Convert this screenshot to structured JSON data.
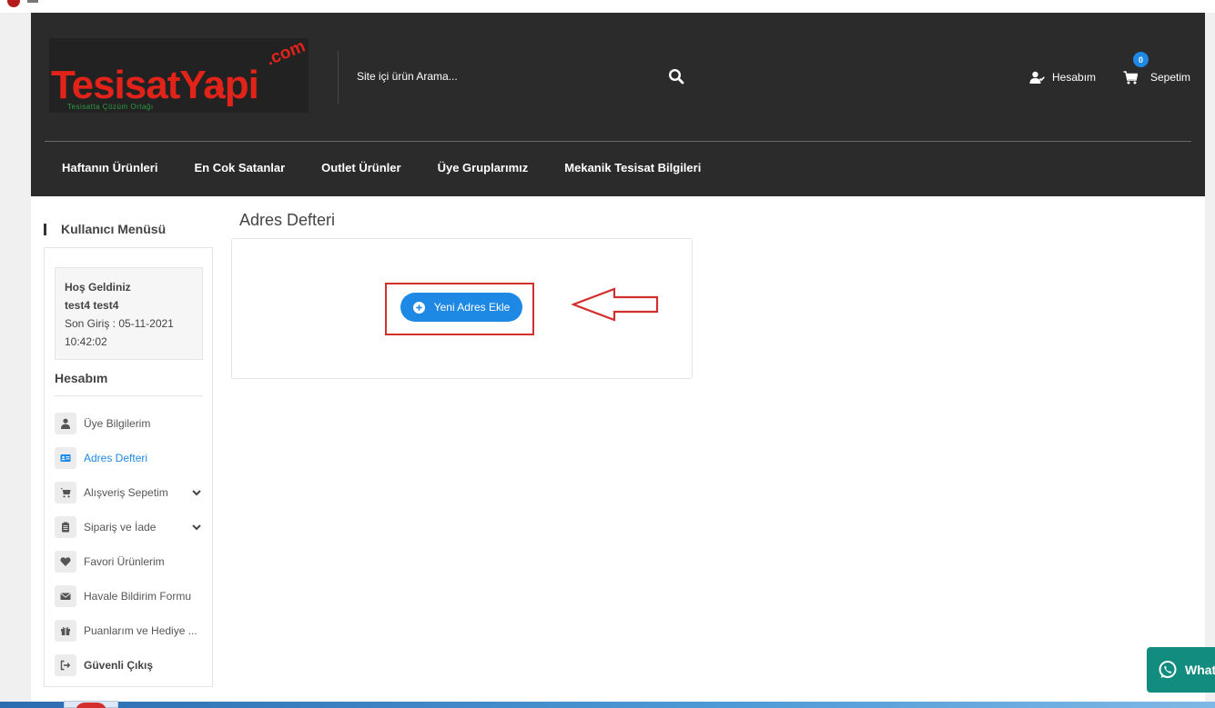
{
  "header": {
    "logo": {
      "main": "TesisatYapi",
      "com": ".com",
      "tagline": "Tesisatta Çözüm Ortağı"
    },
    "search": {
      "placeholder": "Site içi ürün Arama...",
      "icon": "search-icon"
    },
    "account_label": "Hesabım",
    "cart_label": "Sepetim",
    "cart_count": "0",
    "nav": [
      "Haftanın Ürünleri",
      "En Cok Satanlar",
      "Outlet Ürünler",
      "Üye Gruplarımız",
      "Mekanik Tesisat Bilgileri"
    ]
  },
  "sidebar": {
    "title": "Kullanıcı Menüsü",
    "welcome": {
      "greeting": "Hoş Geldiniz",
      "username": "test4 test4",
      "last_login": "Son Giriş : 05-11-2021 10:42:02"
    },
    "section_heading": "Hesabım",
    "items": [
      {
        "label": "Üye Bilgilerim",
        "icon": "user-icon"
      },
      {
        "label": "Adres Defteri",
        "icon": "address-card-icon",
        "active": true
      },
      {
        "label": "Alışveriş Sepetim",
        "icon": "cart-icon",
        "expandable": true
      },
      {
        "label": "Sipariş ve İade",
        "icon": "clipboard-icon",
        "expandable": true
      },
      {
        "label": "Favori Ürünlerim",
        "icon": "heart-icon"
      },
      {
        "label": "Havale Bildirim Formu",
        "icon": "envelope-icon"
      },
      {
        "label": "Puanlarım ve Hediye ...",
        "icon": "gift-icon"
      },
      {
        "label": "Güvenli Çıkış",
        "icon": "logout-icon"
      }
    ]
  },
  "main": {
    "title": "Adres Defteri",
    "add_button_label": "Yeni Adres Ekle"
  },
  "whatsapp": {
    "label": "WhatsApp"
  },
  "colors": {
    "header_bg": "#2b2b2b",
    "accent": "#1e88e5",
    "brand_red": "#e2231a",
    "annotation_red": "#d32f2f",
    "whatsapp": "#128c7e"
  }
}
